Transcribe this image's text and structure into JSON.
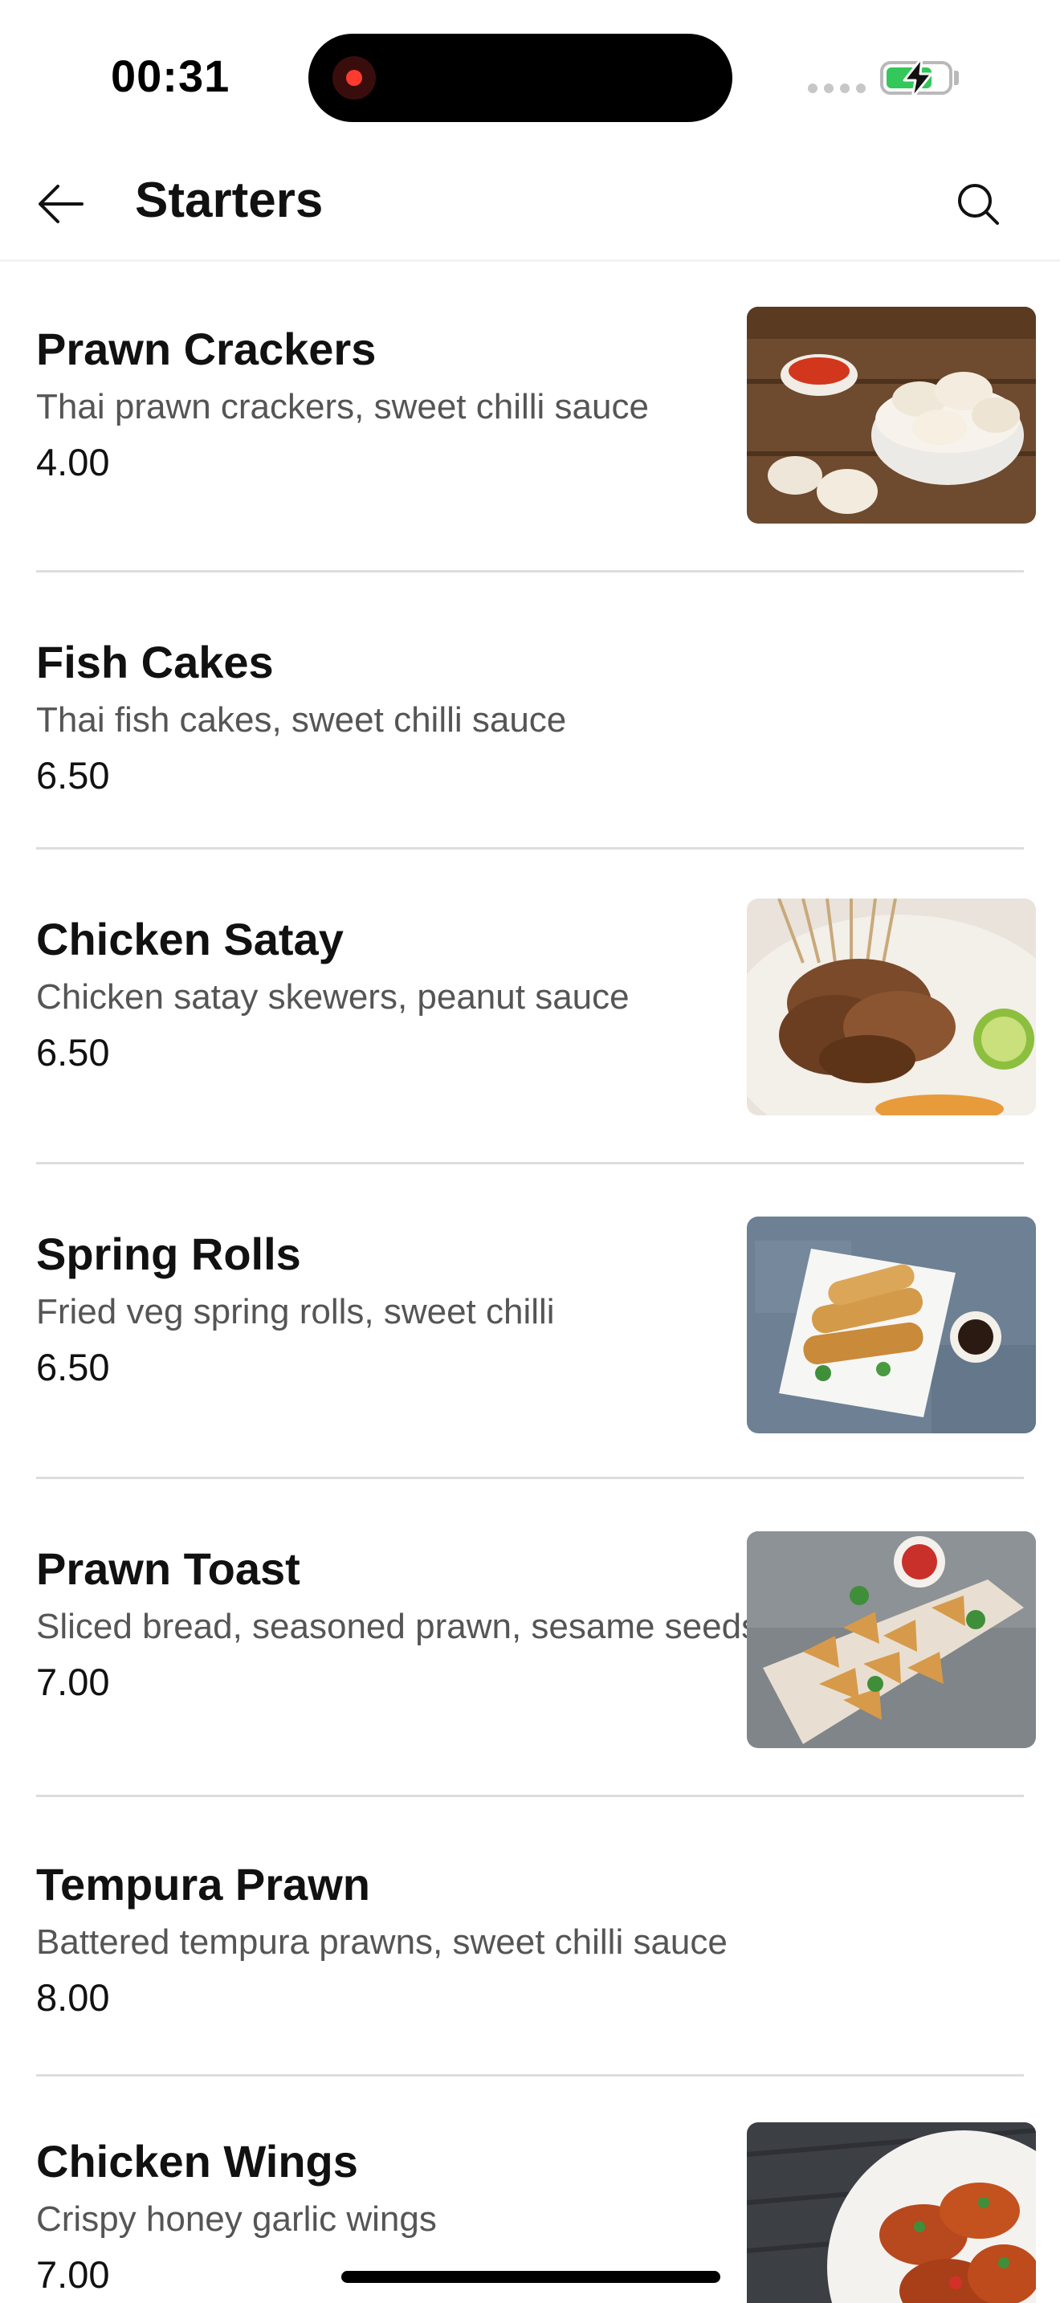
{
  "status_bar": {
    "time": "00:31"
  },
  "header": {
    "title": "Starters",
    "back_icon": "arrow-left-icon",
    "search_icon": "search-icon"
  },
  "menu": {
    "items": [
      {
        "name": "Prawn Crackers",
        "description": "Thai prawn crackers, sweet chilli sauce",
        "price": "4.00",
        "has_image": true
      },
      {
        "name": "Fish Cakes",
        "description": "Thai fish cakes, sweet chilli sauce",
        "price": "6.50",
        "has_image": false
      },
      {
        "name": "Chicken Satay",
        "description": "Chicken satay skewers, peanut sauce",
        "price": "6.50",
        "has_image": true
      },
      {
        "name": "Spring Rolls",
        "description": "Fried veg spring rolls, sweet chilli",
        "price": "6.50",
        "has_image": true
      },
      {
        "name": "Prawn Toast",
        "description": "Sliced bread, seasoned prawn, sesame seeds",
        "price": "7.00",
        "has_image": true
      },
      {
        "name": "Tempura Prawn",
        "description": "Battered tempura prawns, sweet chilli sauce",
        "price": "8.00",
        "has_image": false
      },
      {
        "name": "Chicken Wings",
        "description": "Crispy honey garlic wings",
        "price": "7.00",
        "has_image": true
      }
    ]
  },
  "colors": {
    "accent_green": "#34c759",
    "record_red": "#ff3b30",
    "divider": "#dddddd",
    "description_text": "#555555"
  }
}
